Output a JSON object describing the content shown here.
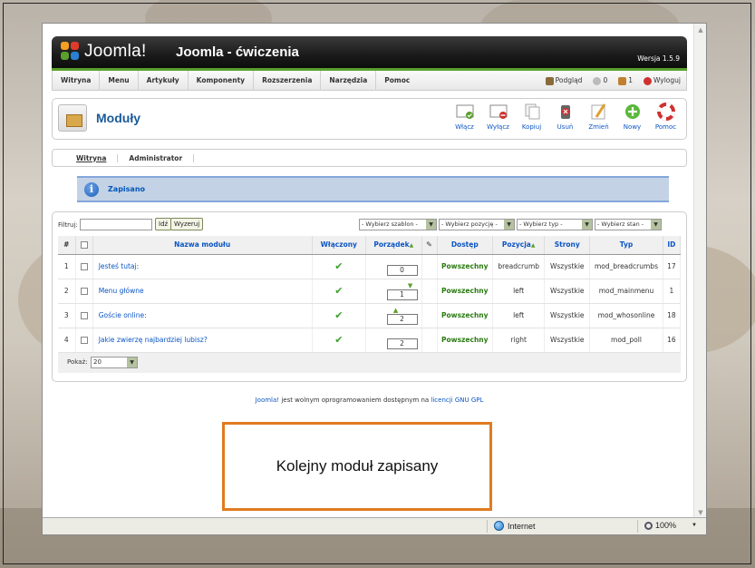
{
  "header": {
    "logo_text": "Joomla!",
    "site_title": "Joomla - ćwiczenia",
    "version": "Wersja 1.5.9"
  },
  "menu": {
    "items": [
      "Witryna",
      "Menu",
      "Artykuły",
      "Komponenty",
      "Rozszerzenia",
      "Narzędzia",
      "Pomoc"
    ],
    "preview": "Podgląd",
    "messages_count": "0",
    "users_count": "1",
    "logout": "Wyloguj"
  },
  "toolbar": {
    "title": "Moduły",
    "buttons": [
      {
        "label": "Włącz",
        "icon": "publish-icon"
      },
      {
        "label": "Wyłącz",
        "icon": "unpublish-icon"
      },
      {
        "label": "Kopiuj",
        "icon": "copy-icon"
      },
      {
        "label": "Usuń",
        "icon": "delete-icon"
      },
      {
        "label": "Zmień",
        "icon": "edit-icon"
      },
      {
        "label": "Nowy",
        "icon": "new-icon"
      },
      {
        "label": "Pomoc",
        "icon": "help-icon"
      }
    ]
  },
  "subnav": {
    "items": [
      "Witryna",
      "Administrator"
    ]
  },
  "message": {
    "text": "Zapisano"
  },
  "filter": {
    "label": "Filtruj:",
    "go_button": "Idź",
    "reset_button": "Wyzeruj",
    "selects": [
      "- Wybierz szablon -",
      "- Wybierz pozycję -",
      "- Wybierz typ -",
      "- Wybierz stan -"
    ]
  },
  "table": {
    "headers": {
      "num": "#",
      "name": "Nazwa modułu",
      "enabled": "Włączony",
      "order": "Porządek",
      "access": "Dostęp",
      "position": "Pozycja",
      "pages": "Strony",
      "type": "Typ",
      "id": "ID"
    },
    "rows": [
      {
        "num": "1",
        "name": "Jesteś tutaj:",
        "order": "0",
        "access": "Powszechny",
        "position": "breadcrumb",
        "pages": "Wszystkie",
        "type": "mod_breadcrumbs",
        "id": "17"
      },
      {
        "num": "2",
        "name": "Menu główne",
        "order": "1",
        "access": "Powszechny",
        "position": "left",
        "pages": "Wszystkie",
        "type": "mod_mainmenu",
        "id": "1"
      },
      {
        "num": "3",
        "name": "Goście online:",
        "order": "2",
        "access": "Powszechny",
        "position": "left",
        "pages": "Wszystkie",
        "type": "mod_whosonline",
        "id": "18"
      },
      {
        "num": "4",
        "name": "Jakie zwierzę najbardziej lubisz?",
        "order": "2",
        "access": "Powszechny",
        "position": "right",
        "pages": "Wszystkie",
        "type": "mod_poll",
        "id": "16"
      }
    ],
    "show_label": "Pokaż:",
    "show_value": "20"
  },
  "footer": {
    "link1": "Joomla!",
    "middle": " jest wolnym oprogramowaniem dostępnym na ",
    "link2": "licencji GNU GPL"
  },
  "status": {
    "zone": "Internet",
    "zoom": "100%"
  },
  "callout": {
    "text": "Kolejny moduł zapisany"
  }
}
